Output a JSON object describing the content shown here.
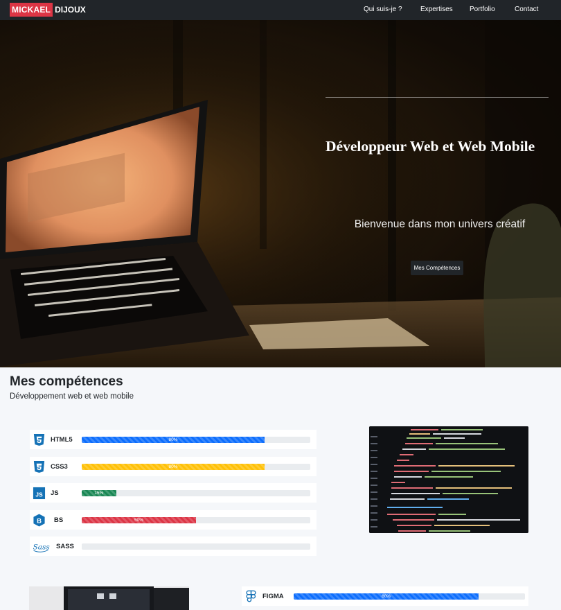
{
  "navbar": {
    "brand_first": "MICKAEL",
    "brand_last": "DIJOUX",
    "items": [
      {
        "label": "Qui suis-je ?"
      },
      {
        "label": "Expertises"
      },
      {
        "label": "Portfolio"
      },
      {
        "label": "Contact"
      }
    ]
  },
  "hero": {
    "title": "Développeur Web et Web Mobile",
    "subtitle": "Bienvenue dans mon univers créatif",
    "button_label": "Mes Compétences"
  },
  "skills": {
    "title": "Mes compétences",
    "subtitle": "Développement web et web mobile",
    "items": [
      {
        "name": "HTML5",
        "icon": "html5-icon",
        "percent": 80,
        "label": "80%",
        "color": "#0d6efd"
      },
      {
        "name": "CSS3",
        "icon": "css3-icon",
        "percent": 80,
        "label": "80%",
        "color": "#ffc107"
      },
      {
        "name": "JS",
        "icon": "js-icon",
        "percent": 15,
        "label": "15%",
        "color": "#198754"
      },
      {
        "name": "BS",
        "icon": "bootstrap-icon",
        "percent": 50,
        "label": "50%",
        "color": "#dc3545"
      },
      {
        "name": "SASS",
        "icon": "sass-icon",
        "percent": 0,
        "label": "",
        "color": "#cd6799"
      },
      {
        "name": "FIGMA",
        "icon": "figma-icon",
        "percent": 80,
        "label": "80%",
        "color": "#0d6efd"
      }
    ]
  },
  "colors": {
    "navbar_bg": "#212529",
    "brand_accent": "#dc3545",
    "page_bg": "#f5f7fa"
  }
}
